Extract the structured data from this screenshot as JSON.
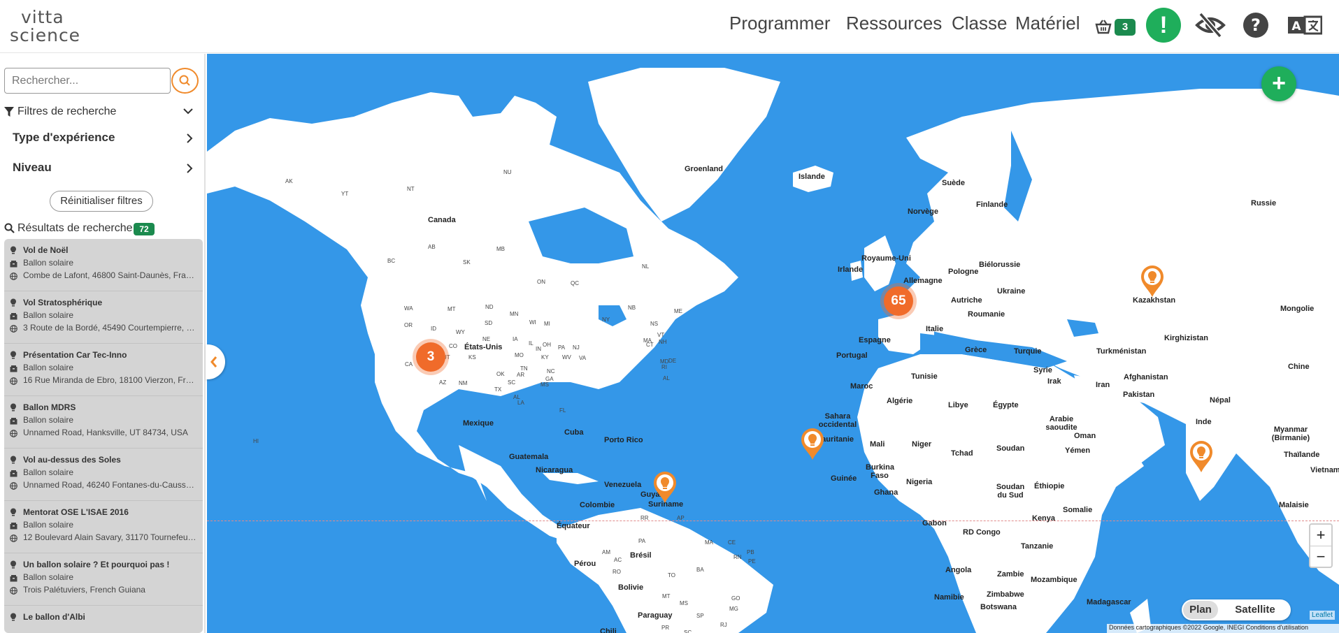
{
  "header": {
    "logo_line1": "vitta",
    "logo_line2": "science",
    "nav": [
      "Programmer",
      "Ressources",
      "Classe",
      "Matériel"
    ],
    "cart_count": "3",
    "alert_symbol": "!",
    "icons": [
      "cart-icon",
      "alert-icon",
      "eye-slash-icon",
      "help-icon",
      "translate-icon"
    ],
    "accent_color": "#1fae5b"
  },
  "sidebar": {
    "search_placeholder": "Rechercher...",
    "filters_label": "Filtres de recherche",
    "filter_type": "Type d'expérience",
    "filter_niveau": "Niveau",
    "reset_label": "Réinitialiser filtres",
    "results_label": "Résultats de recherche",
    "results_count": "72",
    "results": [
      {
        "title": "Vol de Noël",
        "type": "Ballon solaire",
        "address": "Combe de Lafont, 46800 Saint-Daunès, France"
      },
      {
        "title": "Vol Stratosphérique",
        "type": "Ballon solaire",
        "address": "3 Route de la Bordé, 45490 Courtempierre, Fr..."
      },
      {
        "title": "Présentation Car Tec-Inno",
        "type": "Ballon solaire",
        "address": "16 Rue Miranda de Ebro, 18100 Vierzon, France"
      },
      {
        "title": "Ballon MDRS",
        "type": "Ballon solaire",
        "address": "Unnamed Road, Hanksville, UT 84734, USA"
      },
      {
        "title": "Vol au-dessus des Soles",
        "type": "Ballon solaire",
        "address": "Unnamed Road, 46240 Fontanes-du-Causse, F..."
      },
      {
        "title": "Mentorat OSE L'ISAE 2016",
        "type": "Ballon solaire",
        "address": "12 Boulevard Alain Savary, 31170 Tournefeuille, ..."
      },
      {
        "title": "Un ballon solaire ? Et pourquoi pas !",
        "type": "Ballon solaire",
        "address": "Trois Palétuviers, French Guiana"
      },
      {
        "title": "Le ballon d'Albi",
        "type": "",
        "address": ""
      }
    ]
  },
  "map": {
    "add_symbol": "+",
    "clusters": [
      "3",
      "65"
    ],
    "zoom_in": "+",
    "zoom_out": "−",
    "maptype_plan": "Plan",
    "maptype_satellite": "Satellite",
    "leaflet": "Leaflet",
    "google_attribution": "Données cartographiques ©2022 Google, INEGI   Conditions d'utilisation",
    "labels": {
      "groenland": "Groenland",
      "islande": "Islande",
      "suede": "Suède",
      "finlande": "Finlande",
      "russie": "Russie",
      "norvege": "Norvège",
      "canada": "Canada",
      "royaume_uni": "Royaume-Uni",
      "irlande": "Irlande",
      "bielorussie": "Biélorussie",
      "allemagne": "Allemagne",
      "pologne": "Pologne",
      "ukraine": "Ukraine",
      "kazakhstan": "Kazakhstan",
      "mongolie": "Mongolie",
      "autriche": "Autriche",
      "roumanie": "Roumanie",
      "etats_unis": "États-Unis",
      "italie": "Italie",
      "espagne": "Espagne",
      "kirghizistan": "Kirghizistan",
      "portugal": "Portugal",
      "grece": "Grèce",
      "turquie": "Turquie",
      "turkmenistan": "Turkménistan",
      "chine": "Chine",
      "syrie": "Syrie",
      "tunisie": "Tunisie",
      "afghanistan": "Afghanistan",
      "irak": "Irak",
      "iran": "Iran",
      "maroc": "Maroc",
      "algerie": "Algérie",
      "libye": "Libye",
      "egypte": "Égypte",
      "pakistan": "Pakistan",
      "nepal": "Népal",
      "mexique": "Mexique",
      "sahara": "Sahara occidental",
      "arabie": "Arabie saoudite",
      "inde": "Inde",
      "myanmar": "Myanmar (Birmanie)",
      "cuba": "Cuba",
      "porto_rico": "Porto Rico",
      "mauritanie": "Mauritanie",
      "mali": "Mali",
      "niger": "Niger",
      "oman": "Oman",
      "tchad": "Tchad",
      "soudan": "Soudan",
      "yemen": "Yémen",
      "thailande": "Thaïlande",
      "guatemala": "Guatemala",
      "burkina": "Burkina Faso",
      "vietnam": "Vietnam",
      "nicaragua": "Nicaragua",
      "guinee": "Guinée",
      "nigeria": "Nigeria",
      "soudan_sud": "Soudan du Sud",
      "ethiopie": "Éthiopie",
      "venezuela": "Venezuela",
      "ghana": "Ghana",
      "guyana": "Guyana",
      "suriname": "Suriname",
      "somalie": "Somalie",
      "malaisie": "Malaisie",
      "colombie": "Colombie",
      "kenya": "Kenya",
      "gabon": "Gabon",
      "equateur": "Équateur",
      "rd_congo": "RD Congo",
      "tanzanie": "Tanzanie",
      "bresil": "Brésil",
      "perou": "Pérou",
      "angola": "Angola",
      "zambie": "Zambie",
      "mozambique": "Mozambique",
      "bolivie": "Bolivie",
      "namibie": "Namibie",
      "zimbabwe": "Zimbabwe",
      "botswana": "Botswana",
      "madagascar": "Madagascar",
      "paraguay": "Paraguay",
      "chili": "Chili"
    },
    "state_labels": [
      "AK",
      "YT",
      "NT",
      "NU",
      "AB",
      "MB",
      "BC",
      "SK",
      "ON",
      "QC",
      "NL",
      "WA",
      "MT",
      "ND",
      "MN",
      "OR",
      "ID",
      "WY",
      "SD",
      "WI",
      "MI",
      "NY",
      "NE",
      "IA",
      "CA",
      "NV",
      "UT",
      "CO",
      "KS",
      "IL",
      "IN",
      "OH",
      "PA",
      "NJ",
      "MO",
      "KY",
      "WV",
      "VA",
      "AZ",
      "NM",
      "OK",
      "AR",
      "TN",
      "NC",
      "SC",
      "MS",
      "AL",
      "GA",
      "TX",
      "LA",
      "FL",
      "RR",
      "AP",
      "AM",
      "PA2",
      "MA",
      "CE",
      "RN",
      "PB",
      "PE",
      "AC",
      "RO",
      "TO",
      "BA",
      "MT2",
      "GO",
      "MG",
      "MS2",
      "SP",
      "RJ",
      "PR",
      "SC2",
      "NB",
      "NS",
      "ME",
      "VT",
      "NH",
      "MA2",
      "CT",
      "RI",
      "DE",
      "MD",
      "AL2",
      "HI"
    ]
  }
}
